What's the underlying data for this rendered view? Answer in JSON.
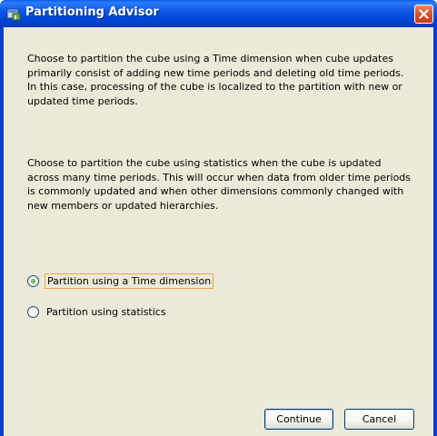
{
  "window": {
    "title": "Partitioning Advisor",
    "icon": "cube-app-icon",
    "close_icon": "close-x-icon"
  },
  "content": {
    "paragraph1": "Choose to partition the cube using a Time dimension when cube updates primarily consist of adding new time periods and deleting old time periods. In this case, processing of the cube is localized to the partition with new or updated time periods.",
    "paragraph2": "Choose to partition the cube using statistics when the cube is updated across many time periods. This will occur when data from older time periods is commonly updated and when other dimensions commonly changed with new members or updated hierarchies."
  },
  "options": [
    {
      "label": "Partition using a Time dimension",
      "selected": true
    },
    {
      "label": "Partition using statistics",
      "selected": false
    }
  ],
  "buttons": {
    "continue_label": "Continue",
    "cancel_label": "Cancel"
  },
  "colors": {
    "titlebar": "#0054e3",
    "dialog_bg": "#ece9d8",
    "close_button": "#d8562d",
    "focus_border": "#e8a93c"
  }
}
